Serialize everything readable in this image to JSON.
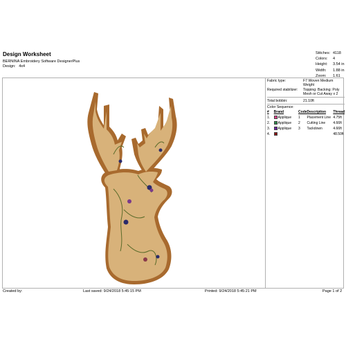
{
  "header": {
    "title": "Design Worksheet",
    "software": "BERNINA Embroidery Software DesignerPlus",
    "design_label": "Design:",
    "design_value": "4x4"
  },
  "stats": [
    {
      "label": "Stitches:",
      "value": "4118"
    },
    {
      "label": "Colors:",
      "value": "4"
    },
    {
      "label": "Height:",
      "value": "3.54 in"
    },
    {
      "label": "Width:",
      "value": "1.88 in"
    },
    {
      "label": "Zoom:",
      "value": "1.61"
    }
  ],
  "info": {
    "fabric_label": "Fabric type:",
    "fabric_value": "F7 Woven Medium Weight",
    "stabilizer_label": "Required stabilizer:",
    "stabilizer_value": "Topping: Backing: Poly Mesh or Cut Away x 2",
    "bobbin_label": "Total bobbin:",
    "bobbin_value": "21.10ft"
  },
  "color_sequence": {
    "title": "Color Sequence:",
    "columns": [
      "#",
      "Brand",
      "Code",
      "Description",
      "Thread"
    ],
    "rows": [
      {
        "num": "1.",
        "color": "#e0408a",
        "brand": "Applique",
        "code": "1",
        "description": "Placement Line",
        "thread": "4.75ft"
      },
      {
        "num": "2.",
        "color": "#2f8a4a",
        "brand": "Applique",
        "code": "2",
        "description": "Cutting Line",
        "thread": "4.66ft"
      },
      {
        "num": "3.",
        "color": "#6a1fa0",
        "brand": "Applique",
        "code": "3",
        "description": "Tackdown",
        "thread": "4.66ft"
      },
      {
        "num": "4.",
        "color": "#8a1515",
        "brand": "",
        "code": "",
        "description": "",
        "thread": "48.50ft"
      }
    ]
  },
  "footer": {
    "created": "Created by:",
    "saved": "Last saved: 9/24/2018 5:45:15 PM",
    "printed": "Printed: 9/24/2018 5:45:21 PM",
    "page": "Page 1 of 2"
  },
  "colors": {
    "outline_brown": "#a86a2e",
    "fabric_tan": "#d8b27a",
    "border_gray": "#b0b0b0"
  }
}
